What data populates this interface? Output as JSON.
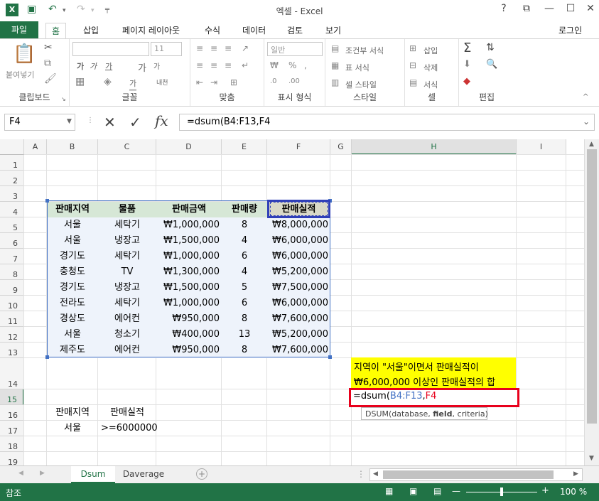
{
  "window": {
    "title": "엑셀 - Excel",
    "help": "?",
    "login": "로그인"
  },
  "tabs": {
    "file": "파일",
    "home": "홈",
    "insert": "삽입",
    "layout": "페이지 레이아웃",
    "formulas": "수식",
    "data": "데이터",
    "review": "검토",
    "view": "보기"
  },
  "ribbon": {
    "clipboard": {
      "label": "클립보드",
      "paste": "붙여넣기"
    },
    "font": {
      "label": "글꼴",
      "size": "11",
      "bold": "가",
      "italic": "가",
      "underline": "가",
      "grow": "가",
      "shrink": "가",
      "font_color": "가",
      "phonetic": "내천"
    },
    "align": {
      "label": "맞춤"
    },
    "number": {
      "label": "표시 형식",
      "format": "일반"
    },
    "styles": {
      "label": "스타일",
      "cond": "조건부 서식",
      "table": "표 서식",
      "cell": "셀 스타일"
    },
    "cells": {
      "label": "셀",
      "insert": "삽입",
      "delete": "삭제",
      "format": "서식"
    },
    "editing": {
      "label": "편집"
    }
  },
  "formula_bar": {
    "name_box": "F4",
    "formula": "=dsum(B4:F13,F4"
  },
  "columns": [
    "A",
    "B",
    "C",
    "D",
    "E",
    "F",
    "G",
    "H",
    "I"
  ],
  "rows": [
    "1",
    "2",
    "3",
    "4",
    "5",
    "6",
    "7",
    "8",
    "9",
    "10",
    "11",
    "12",
    "13",
    "14",
    "15",
    "16",
    "17",
    "18",
    "19"
  ],
  "table": {
    "headers": [
      "판매지역",
      "물품",
      "판매금액",
      "판매량",
      "판매실적"
    ],
    "data": [
      [
        "서울",
        "세탁기",
        "₩1,000,000",
        "8",
        "₩8,000,000"
      ],
      [
        "서울",
        "냉장고",
        "₩1,500,000",
        "4",
        "₩6,000,000"
      ],
      [
        "경기도",
        "세탁기",
        "₩1,000,000",
        "6",
        "₩6,000,000"
      ],
      [
        "충청도",
        "TV",
        "₩1,300,000",
        "4",
        "₩5,200,000"
      ],
      [
        "경기도",
        "냉장고",
        "₩1,500,000",
        "5",
        "₩7,500,000"
      ],
      [
        "전라도",
        "세탁기",
        "₩1,000,000",
        "6",
        "₩6,000,000"
      ],
      [
        "경상도",
        "에어컨",
        "₩950,000",
        "8",
        "₩7,600,000"
      ],
      [
        "서울",
        "청소기",
        "₩400,000",
        "13",
        "₩5,200,000"
      ],
      [
        "제주도",
        "에어컨",
        "₩950,000",
        "8",
        "₩7,600,000"
      ]
    ]
  },
  "criteria": {
    "h1": "판매지역",
    "h2": "판매실적",
    "v1": "서울",
    "v2": ">=6000000"
  },
  "note": {
    "line1": "지역이 \"서울\"이면서 판매실적이",
    "line2a": "₩6,000,000 이상인 ",
    "line2b": "판매실적의 합"
  },
  "editing_cell": {
    "prefix": "=dsum(",
    "ref1": "B4:F13",
    "comma": ",",
    "ref2": "F4"
  },
  "tooltip": {
    "fn": "DSUM(database, ",
    "arg": "field",
    "rest": ", criteria)"
  },
  "sheets": [
    "Dsum",
    "Daverage"
  ],
  "status": {
    "mode": "참조",
    "zoom": "100 %"
  },
  "colors": {
    "accent": "#217346",
    "ref_blue": "#4472c4",
    "ref_red": "#c00000",
    "note_bg": "#ffff00"
  }
}
